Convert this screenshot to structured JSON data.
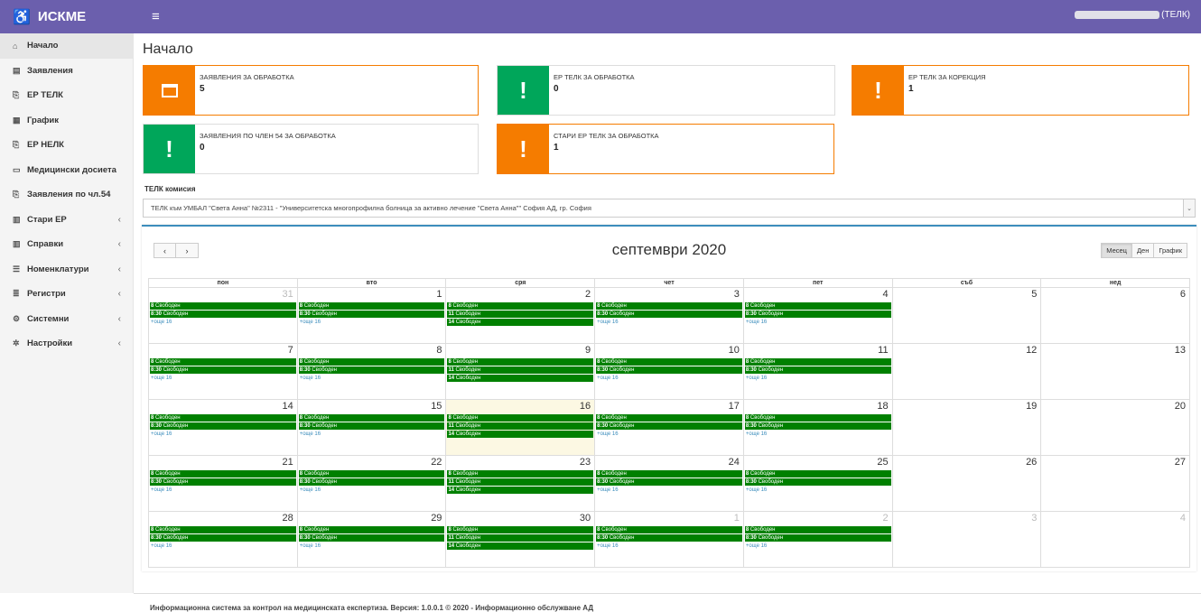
{
  "app": {
    "brand": "ИСКМЕ",
    "menu_icon": "≡",
    "user_suffix": "(ТЕЛК)"
  },
  "sidebar": {
    "items": [
      {
        "label": "Начало",
        "icon": "home-icon",
        "glyph": "⌂",
        "chevron": false
      },
      {
        "label": "Заявления",
        "icon": "file-icon",
        "glyph": "▤",
        "chevron": false
      },
      {
        "label": "ЕР ТЕЛК",
        "icon": "clipboard-icon",
        "glyph": "⎘",
        "chevron": false
      },
      {
        "label": "График",
        "icon": "calendar-icon",
        "glyph": "▦",
        "chevron": false
      },
      {
        "label": "ЕР НЕЛК",
        "icon": "clipboard-icon",
        "glyph": "⎘",
        "chevron": false
      },
      {
        "label": "Медицински досиета",
        "icon": "folder-icon",
        "glyph": "▭",
        "chevron": false
      },
      {
        "label": "Заявления по чл.54",
        "icon": "clipboard-icon",
        "glyph": "⎘",
        "chevron": false
      },
      {
        "label": "Стари ЕР",
        "icon": "table-icon",
        "glyph": "▥",
        "chevron": true
      },
      {
        "label": "Справки",
        "icon": "table-icon",
        "glyph": "▥",
        "chevron": true
      },
      {
        "label": "Номенклатури",
        "icon": "list-icon",
        "glyph": "☰",
        "chevron": true
      },
      {
        "label": "Регистри",
        "icon": "book-icon",
        "glyph": "≣",
        "chevron": true
      },
      {
        "label": "Системни",
        "icon": "cogs-icon",
        "glyph": "⚙",
        "chevron": true
      },
      {
        "label": "Настройки",
        "icon": "gear-icon",
        "glyph": "✲",
        "chevron": true
      }
    ]
  },
  "page": {
    "title": "Начало"
  },
  "cards": [
    {
      "label": "ЗАЯВЛЕНИЯ ЗА ОБРАБОТКА",
      "value": "5",
      "color": "orange",
      "icon": "calendar-icon"
    },
    {
      "label": "ЕР ТЕЛК ЗА ОБРАБОТКА",
      "value": "0",
      "color": "green",
      "icon": "exclamation-icon"
    },
    {
      "label": "ЕР ТЕЛК ЗА КОРЕКЦИЯ",
      "value": "1",
      "color": "orange",
      "icon": "exclamation-icon"
    },
    {
      "label": "ЗАЯВЛЕНИЯ ПО ЧЛЕН 54 ЗА ОБРАБОТКА",
      "value": "0",
      "color": "green",
      "icon": "exclamation-icon"
    },
    {
      "label": "СТАРИ ЕР ТЕЛК ЗА ОБРАБОТКА",
      "value": "1",
      "color": "orange",
      "icon": "exclamation-icon"
    }
  ],
  "telk": {
    "label": "ТЕЛК комисия",
    "value": "ТЕЛК към УМБАЛ \"Света Анна\" №2311 - \"Университетска многопрофилна болница за активно лечение \"Света Анна\"\" София АД, гр. София"
  },
  "calendar": {
    "title": "септември 2020",
    "prev": "‹",
    "next": "›",
    "views": [
      "Месец",
      "Ден",
      "График"
    ],
    "active_view": "Месец",
    "weekdays": [
      "пон",
      "вто",
      "сря",
      "чет",
      "пет",
      "съб",
      "нед"
    ],
    "weeks": [
      [
        "31",
        "1",
        "2",
        "3",
        "4",
        "5",
        "6"
      ],
      [
        "7",
        "8",
        "9",
        "10",
        "11",
        "12",
        "13"
      ],
      [
        "14",
        "15",
        "16",
        "17",
        "18",
        "19",
        "20"
      ],
      [
        "21",
        "22",
        "23",
        "24",
        "25",
        "26",
        "27"
      ],
      [
        "28",
        "29",
        "30",
        "1",
        "2",
        "3",
        "4"
      ]
    ],
    "other_month": [
      [
        0
      ],
      [],
      [],
      [],
      [
        3,
        4,
        5,
        6
      ]
    ],
    "today": [
      2,
      2
    ],
    "events_weekday": [
      {
        "time": "8",
        "text": "Свободен"
      },
      {
        "time": "8:30",
        "text": "Свободен"
      }
    ],
    "events_wednesday": [
      {
        "time": "8",
        "text": "Свободен"
      },
      {
        "time": "11",
        "text": "Свободен"
      },
      {
        "time": "14",
        "text": "Свободен"
      }
    ],
    "more_label": "+още 16",
    "event_color": "#008000"
  },
  "footer": {
    "text": "Информационна система за контрол на медицинската експертиза. Версия: 1.0.0.1 © 2020 - Информационно обслужване АД"
  },
  "colors": {
    "header": "#6b5fad",
    "orange": "#f57c00",
    "green": "#00a65a",
    "accent": "#3c8dbc"
  }
}
